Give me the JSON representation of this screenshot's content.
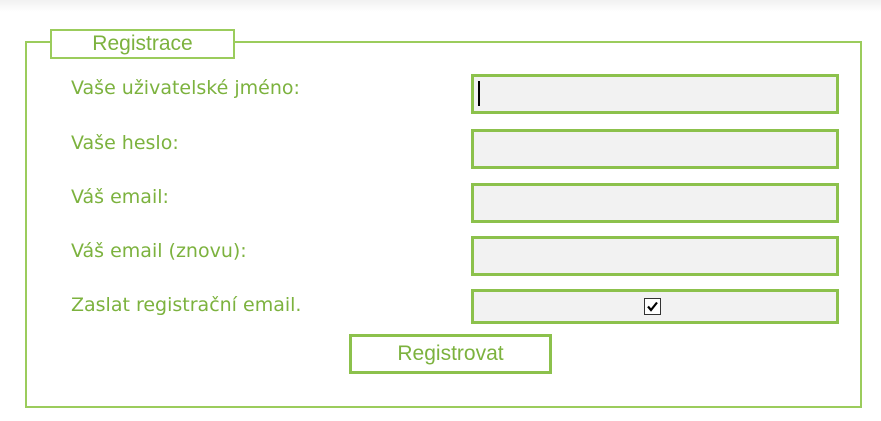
{
  "form": {
    "legend": "Registrace",
    "fields": [
      {
        "label": "Vaše uživatelské jméno:",
        "value": "",
        "placeholder": ""
      },
      {
        "label": "Vaše heslo:",
        "value": "",
        "placeholder": ""
      },
      {
        "label": "Váš email:",
        "value": "",
        "placeholder": ""
      },
      {
        "label": "Váš email (znovu):",
        "value": "",
        "placeholder": ""
      }
    ],
    "send_email": {
      "label": "Zaslat registrační email.",
      "checked": true
    },
    "submit_label": "Registrovat"
  },
  "colors": {
    "accent": "#8cc14c",
    "label_text": "#7cb23e",
    "input_background": "#f2f2f2"
  }
}
